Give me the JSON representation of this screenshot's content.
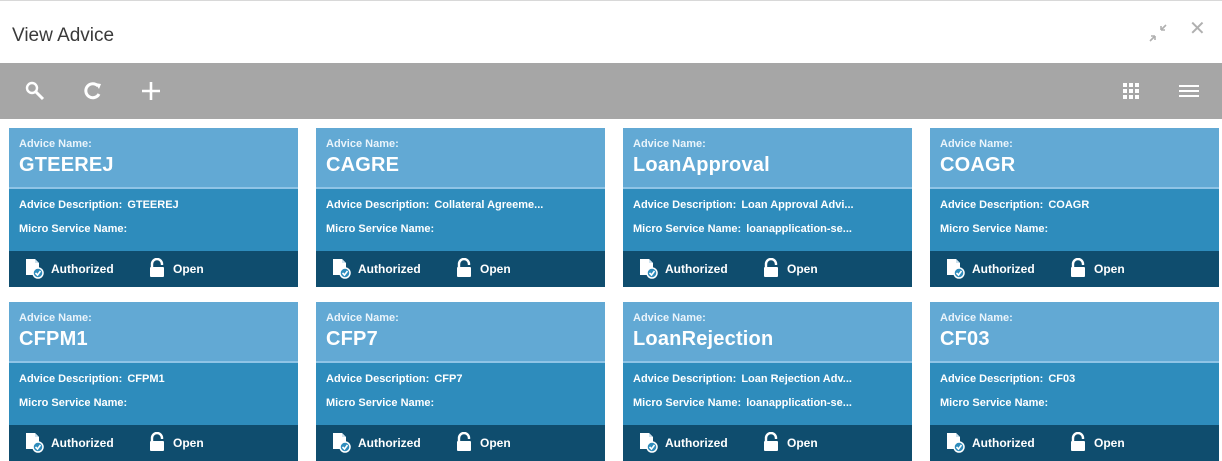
{
  "window": {
    "title": "View Advice"
  },
  "labels": {
    "advice_name": "Advice Name:",
    "advice_description": "Advice Description:",
    "micro_service_name": "Micro Service Name:"
  },
  "cards": [
    {
      "name": "GTEEREJ",
      "description": "GTEEREJ",
      "micro_service": "",
      "status": "Authorized",
      "lock": "Open"
    },
    {
      "name": "CAGRE",
      "description": "Collateral Agreeme...",
      "micro_service": "",
      "status": "Authorized",
      "lock": "Open"
    },
    {
      "name": "LoanApproval",
      "description": "Loan Approval Advi...",
      "micro_service": "loanapplication-se...",
      "status": "Authorized",
      "lock": "Open"
    },
    {
      "name": "COAGR",
      "description": "COAGR",
      "micro_service": "",
      "status": "Authorized",
      "lock": "Open"
    },
    {
      "name": "CFPM1",
      "description": "CFPM1",
      "micro_service": "",
      "status": "Authorized",
      "lock": "Open"
    },
    {
      "name": "CFP7",
      "description": "CFP7",
      "micro_service": "",
      "status": "Authorized",
      "lock": "Open"
    },
    {
      "name": "LoanRejection",
      "description": "Loan Rejection Adv...",
      "micro_service": "loanapplication-se...",
      "status": "Authorized",
      "lock": "Open"
    },
    {
      "name": "CF03",
      "description": "CF03",
      "micro_service": "",
      "status": "Authorized",
      "lock": "Open"
    }
  ],
  "icons": {
    "search": "search-icon",
    "refresh": "refresh-icon",
    "add": "plus-icon",
    "grid_view": "grid-view-icon",
    "list_view": "list-view-icon",
    "minimize": "minimize-icon",
    "close": "close-icon"
  },
  "colors": {
    "toolbar": "#a6a6a6",
    "card_head": "#62a9d4",
    "card_body": "#2e8cbc",
    "card_foot": "#0f4d6e"
  }
}
